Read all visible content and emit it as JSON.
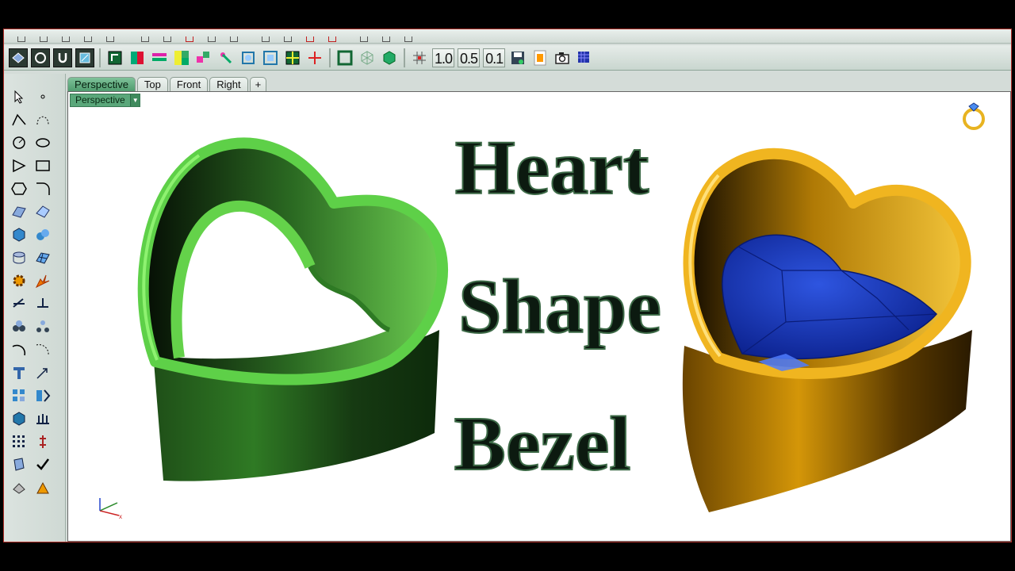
{
  "viewport_tabs": [
    "Perspective",
    "Top",
    "Front",
    "Right",
    "+"
  ],
  "active_viewport": "Perspective",
  "viewport_label": "Perspective",
  "toolbar_numbers": [
    "1.0",
    "0.5",
    "0.1"
  ],
  "title": {
    "line1": "Heart",
    "line2": "Shape",
    "line3": "Bezel"
  },
  "colors": {
    "green_bezel": "#3d9a2e",
    "gold_bezel": "#e3a20c",
    "gem_blue": "#1f3fbf",
    "accent_frame": "#b0302a"
  },
  "icons": {
    "top_toolbar": [
      "select-icon",
      "point-icon",
      "curve-icon",
      "curve-edit-icon",
      "circle-icon",
      "ellipse-icon",
      "polygon-icon",
      "rectangle-icon",
      "arc-icon",
      "fillet-icon",
      "surface-icon",
      "surface-edit-icon",
      "box-icon",
      "sphere-icon",
      "cylinder-icon",
      "mesh-icon",
      "gear-icon",
      "explode-icon",
      "transform-icon",
      "boolean-icon",
      "text-icon",
      "scale-icon",
      "array-icon",
      "check-icon",
      "shade-icon",
      "render-icon"
    ],
    "corner_icon": "ring-icon",
    "axis_icon": "axis-icon"
  }
}
